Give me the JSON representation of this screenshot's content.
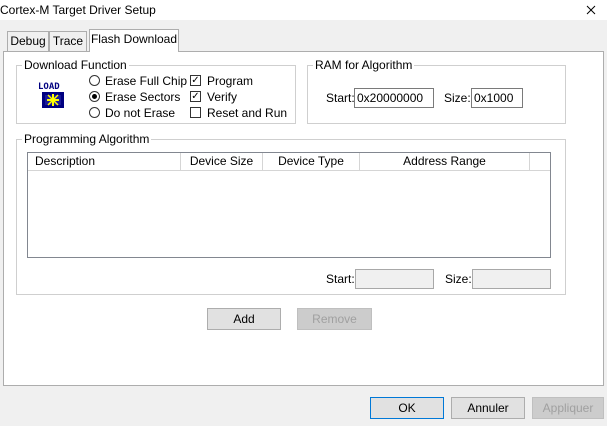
{
  "window": {
    "title": "Cortex-M Target Driver Setup",
    "close_glyph": "✕"
  },
  "tabs": [
    {
      "label": "Debug"
    },
    {
      "label": "Trace"
    },
    {
      "label": "Flash Download",
      "active": true
    }
  ],
  "download_function": {
    "title": "Download Function",
    "icon": "load-icon",
    "icon_text": "LOAD",
    "radios": [
      {
        "label": "Erase Full Chip",
        "checked": false
      },
      {
        "label": "Erase Sectors",
        "checked": true
      },
      {
        "label": "Do not Erase",
        "checked": false
      }
    ],
    "checkboxes": [
      {
        "label": "Program",
        "checked": true
      },
      {
        "label": "Verify",
        "checked": true
      },
      {
        "label": "Reset and Run",
        "checked": false
      }
    ]
  },
  "ram": {
    "title": "RAM for Algorithm",
    "start_label": "Start:",
    "start_value": "0x20000000",
    "size_label": "Size:",
    "size_value": "0x1000"
  },
  "programming_algorithm": {
    "title": "Programming Algorithm",
    "columns": [
      "Description",
      "Device Size",
      "Device Type",
      "Address Range"
    ],
    "rows": [],
    "start_label": "Start:",
    "start_value": "",
    "size_label": "Size:",
    "size_value": ""
  },
  "actions": {
    "add_label": "Add",
    "remove_label": "Remove"
  },
  "footer": {
    "ok_label": "OK",
    "cancel_label": "Annuler",
    "apply_label": "Appliquer"
  },
  "colors": {
    "panel_bg": "#ffffff",
    "dialog_bg": "#f0f0f0",
    "focus_border": "#0078d7",
    "disabled_text": "#a0a0a0"
  }
}
